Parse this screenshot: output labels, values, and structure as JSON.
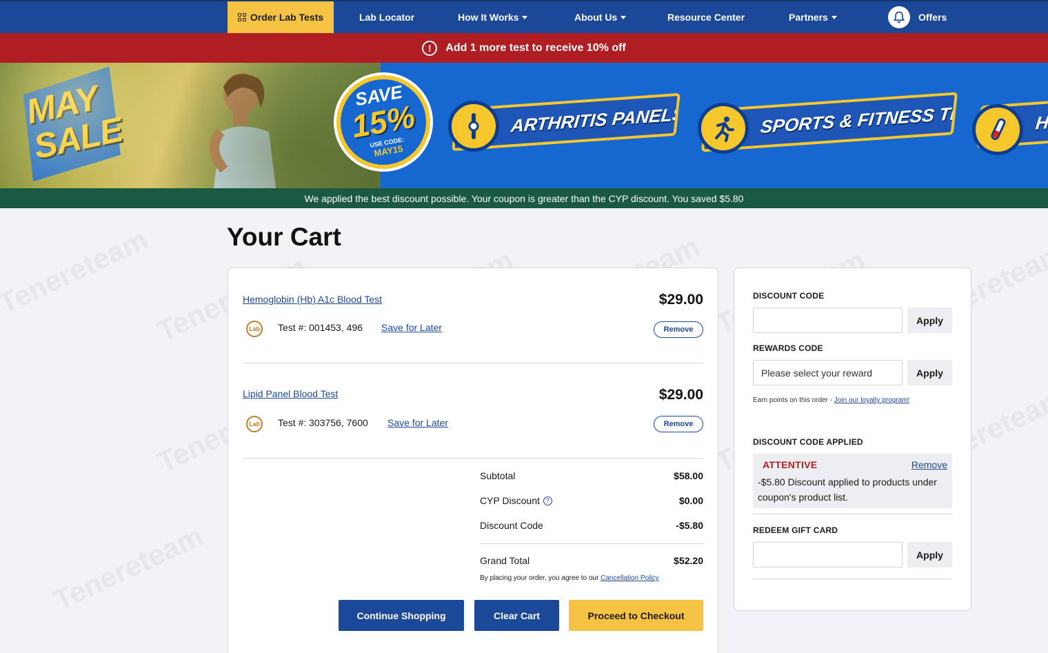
{
  "nav": {
    "items": [
      {
        "label": "Order Lab Tests"
      },
      {
        "label": "Lab Locator"
      },
      {
        "label": "How It Works"
      },
      {
        "label": "About Us"
      },
      {
        "label": "Resource Center"
      },
      {
        "label": "Partners"
      },
      {
        "label": "Offers"
      }
    ]
  },
  "promo": {
    "text": "Add 1 more test to receive 10% off",
    "icon": "alert-icon"
  },
  "banner": {
    "may_sale": "MAY SALE",
    "save": "SAVE",
    "percent": "15%",
    "use_code": "USE CODE:",
    "code": "MAY15",
    "pills": [
      "ARTHRITIS PANELS",
      "SPORTS & FITNESS TESTS",
      "HI"
    ]
  },
  "notice": "We applied the best discount possible. Your coupon is greater than the CYP discount. You saved $5.80",
  "page_title": "Your Cart",
  "cart": {
    "items": [
      {
        "name": "Hemoglobin (Hb) A1c Blood Test",
        "price": "$29.00",
        "test_no": "Test #: 001453, 496",
        "save_later": "Save for Later",
        "remove": "Remove"
      },
      {
        "name": "Lipid Panel Blood Test",
        "price": "$29.00",
        "test_no": "Test #: 303756, 7600",
        "save_later": "Save for Later",
        "remove": "Remove"
      }
    ],
    "lab_icon_text": "Lab",
    "summary": {
      "subtotal_label": "Subtotal",
      "subtotal": "$58.00",
      "cyp_label": "CYP Discount",
      "cyp": "$0.00",
      "discount_label": "Discount Code",
      "discount": "-$5.80",
      "grand_label": "Grand Total",
      "grand": "$52.20"
    },
    "agree_text": "By placing your order, you agree to our ",
    "agree_link": "Cancellation Policy",
    "buttons": {
      "continue": "Continue Shopping",
      "clear": "Clear Cart",
      "checkout": "Proceed to Checkout"
    }
  },
  "side": {
    "discount_label": "DISCOUNT CODE",
    "discount_value": "",
    "apply": "Apply",
    "rewards_label": "REWARDS CODE",
    "rewards_placeholder": "Please select your reward",
    "earn_text": "Earn points on this order - ",
    "earn_link": "Join our loyalty program!",
    "applied_label": "DISCOUNT CODE APPLIED",
    "applied_name": "ATTENTIVE",
    "applied_remove": "Remove",
    "applied_desc": "-$5.80  Discount applied to products under coupon's product list.",
    "gift_label": "REDEEM GIFT CARD",
    "gift_value": ""
  },
  "watermark": "Tenereteam",
  "colors": {
    "nav": "#1c4898",
    "accent": "#f6c244",
    "promo": "#b01e23",
    "notice": "#1a5942"
  }
}
